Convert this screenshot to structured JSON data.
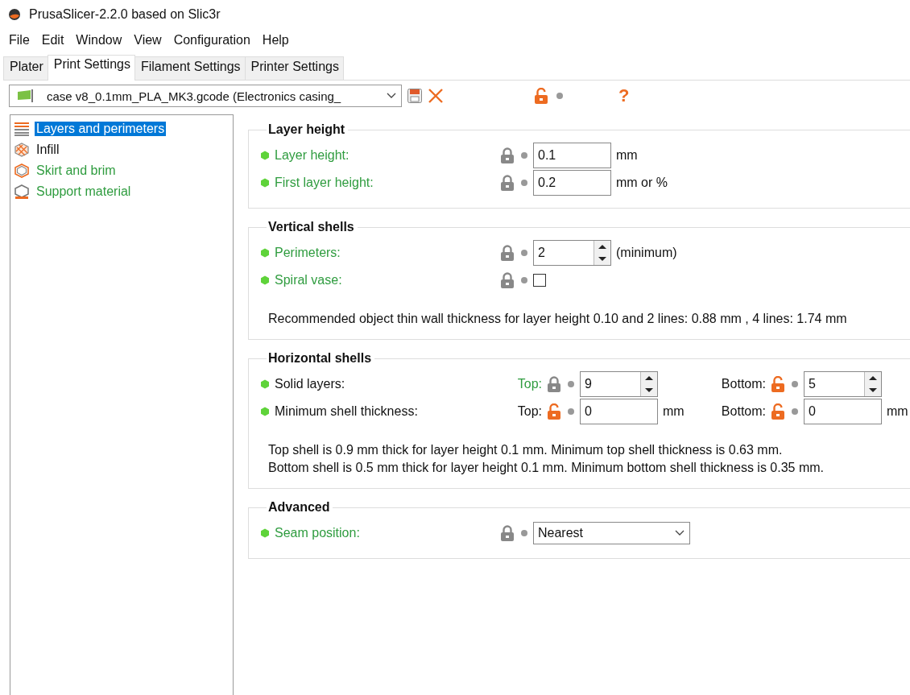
{
  "window": {
    "title": "PrusaSlicer-2.2.0 based on Slic3r"
  },
  "menu": [
    "File",
    "Edit",
    "Window",
    "View",
    "Configuration",
    "Help"
  ],
  "tabs": [
    {
      "label": "Plater",
      "selected": false
    },
    {
      "label": "Print Settings",
      "selected": true
    },
    {
      "label": "Filament Settings",
      "selected": false
    },
    {
      "label": "Printer Settings",
      "selected": false
    }
  ],
  "preset": {
    "value": "case v8_0.1mm_PLA_MK3.gcode (Electronics casing_",
    "locked": false,
    "help": "?"
  },
  "sidebar": {
    "items": [
      {
        "label": "Layers and perimeters",
        "selected": true,
        "system_value": false,
        "kind": "layers"
      },
      {
        "label": "Infill",
        "selected": false,
        "system_value": false,
        "kind": "infill"
      },
      {
        "label": "Skirt and brim",
        "selected": false,
        "system_value": true,
        "kind": "skirt"
      },
      {
        "label": "Support material",
        "selected": false,
        "system_value": true,
        "kind": "support"
      }
    ]
  },
  "sections": [
    {
      "title": "Layer height",
      "rows": [
        {
          "kind": "field",
          "label": "Layer height:",
          "system_value": true,
          "locked": true,
          "value": "0.1",
          "unit": "mm"
        },
        {
          "kind": "field",
          "label": "First layer height:",
          "system_value": true,
          "locked": true,
          "value": "0.2",
          "unit": "mm or %"
        }
      ]
    },
    {
      "title": "Vertical shells",
      "rows": [
        {
          "kind": "spin",
          "label": "Perimeters:",
          "system_value": true,
          "locked": true,
          "value": "2",
          "unit": "(minimum)"
        },
        {
          "kind": "checkbox",
          "label": "Spiral vase:",
          "system_value": true,
          "locked": true,
          "checked": false
        }
      ],
      "notes": [
        "Recommended object thin wall thickness for layer height 0.10 and 2 lines: 0.88 mm , 4 lines: 1.74 mm"
      ]
    },
    {
      "title": "Horizontal shells",
      "rows": [
        {
          "kind": "pair",
          "label": "Solid layers:",
          "system_value": false,
          "parts": [
            {
              "kind": "spin",
              "sublabel": "Top:",
              "system_value": true,
              "locked": true,
              "value": "9"
            },
            {
              "kind": "spin",
              "sublabel": "Bottom:",
              "system_value": false,
              "locked": false,
              "value": "5"
            }
          ]
        },
        {
          "kind": "pair",
          "label": "Minimum shell thickness:",
          "system_value": false,
          "parts": [
            {
              "kind": "field",
              "sublabel": "Top:",
              "system_value": false,
              "locked": false,
              "value": "0",
              "unit": "mm"
            },
            {
              "kind": "field",
              "sublabel": "Bottom:",
              "system_value": false,
              "locked": false,
              "value": "0",
              "unit": "mm"
            }
          ]
        }
      ],
      "notes": [
        "Top shell is 0.9 mm thick for layer height 0.1 mm. Minimum top shell thickness is 0.63 mm.",
        "Bottom shell is 0.5 mm thick for layer height 0.1 mm. Minimum bottom shell thickness is 0.35 mm."
      ]
    },
    {
      "title": "Advanced",
      "rows": [
        {
          "kind": "select",
          "label": "Seam position:",
          "system_value": true,
          "locked": true,
          "value": "Nearest"
        }
      ]
    }
  ]
}
